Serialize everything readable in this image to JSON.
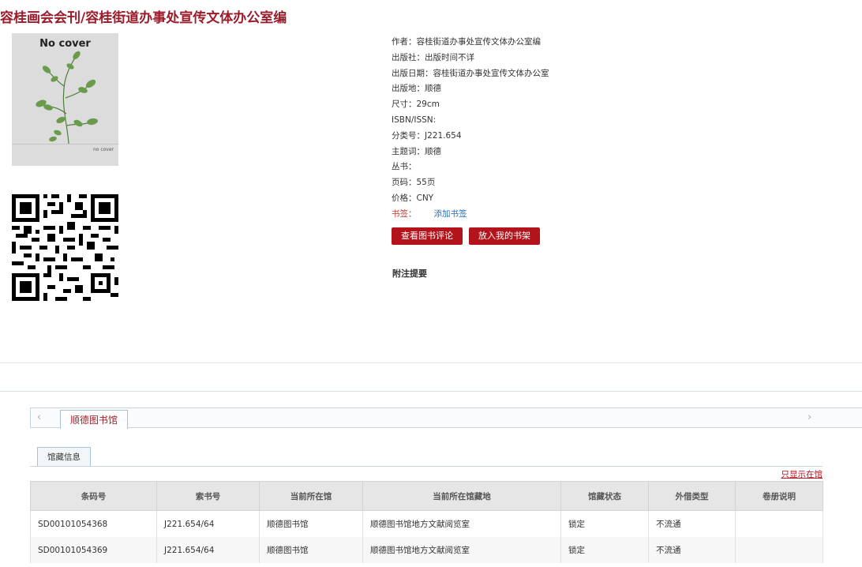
{
  "title": "容桂画会会刊/容桂街道办事处宣传文体办公室编",
  "cover": {
    "top_text": "No cover",
    "bottom_text": "no cover"
  },
  "meta": [
    {
      "label": "作者：",
      "value": "容桂街道办事处宣传文体办公室编"
    },
    {
      "label": "出版社：",
      "value": "出版时间不详"
    },
    {
      "label": "出版日期：",
      "value": "容桂街道办事处宣传文体办公室"
    },
    {
      "label": "出版地：",
      "value": "顺德"
    },
    {
      "label": "尺寸：",
      "value": "29cm"
    },
    {
      "label": "ISBN/ISSN:",
      "value": ""
    },
    {
      "label": "分类号：",
      "value": "J221.654"
    },
    {
      "label": "主题词：",
      "value": "顺德"
    },
    {
      "label": "丛书：",
      "value": ""
    },
    {
      "label": "页码：",
      "value": "55页"
    },
    {
      "label": "价格：",
      "value": "CNY"
    }
  ],
  "tag": {
    "label": "书签：",
    "link": "添加书签"
  },
  "buttons": {
    "review": "查看图书评论",
    "shelf": "放入我的书架"
  },
  "notes_heading": "附注提要",
  "tabs": {
    "library": "顺德图书馆",
    "holdings": "馆藏信息",
    "arrow_left": "‹",
    "arrow_right": "›"
  },
  "filter_link": "只显示在馆",
  "table": {
    "headers": [
      "条码号",
      "索书号",
      "当前所在馆",
      "当前所在馆藏地",
      "馆藏状态",
      "外借类型",
      "卷册说明"
    ],
    "rows": [
      [
        "SD00101054368",
        "J221.654/64",
        "顺德图书馆",
        "顺德图书馆地方文献阅览室",
        "锁定",
        "不流通",
        ""
      ],
      [
        "SD00101054369",
        "J221.654/64",
        "顺德图书馆",
        "顺德图书馆地方文献阅览室",
        "锁定",
        "不流通",
        ""
      ]
    ]
  },
  "colors": {
    "accent": "#b3141c",
    "title": "#9b1c2a",
    "link": "#2a6db5"
  },
  "icons": [
    "leaf-plant-illustration",
    "qr-code",
    "chevron-left-icon",
    "chevron-right-icon"
  ]
}
